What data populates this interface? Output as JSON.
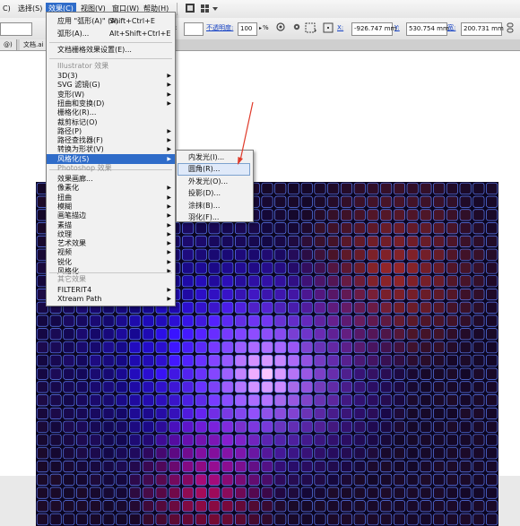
{
  "menubar": {
    "items": [
      {
        "label": "C)"
      },
      {
        "label": "选择(S)"
      },
      {
        "label": "效果(C)"
      },
      {
        "label": "视图(V)"
      },
      {
        "label": "窗口(W)"
      },
      {
        "label": "帮助(H)"
      }
    ]
  },
  "controlbar": {
    "style_suffix": "式:",
    "opacity_label": "不透明度:",
    "opacity_value": "100",
    "percent": "%",
    "x_label": "X:",
    "x_value": "-926.747 mm",
    "y_label": "Y:",
    "y_value": "530.754 mm",
    "w_label": "宽:",
    "w_value": "200.731 mm"
  },
  "tabs": [
    {
      "label": "@)"
    },
    {
      "label": "文档.ai"
    }
  ],
  "effect_menu": {
    "apply_last": {
      "label": "应用 \"弧形(A)\" (A)",
      "shortcut": "Shift+Ctrl+E"
    },
    "last_effect": {
      "label": "弧形(A)...",
      "shortcut": "Alt+Shift+Ctrl+E"
    },
    "doc_raster": {
      "label": "文档栅格效果设置(E)..."
    },
    "illustrator_heading": "Illustrator 效果",
    "illustrator_items": [
      {
        "label": "3D(3)",
        "submenu": true
      },
      {
        "label": "SVG 滤镜(G)",
        "submenu": true
      },
      {
        "label": "变形(W)",
        "submenu": true
      },
      {
        "label": "扭曲和变换(D)",
        "submenu": true
      },
      {
        "label": "栅格化(R)...",
        "submenu": false
      },
      {
        "label": "裁剪标记(O)",
        "submenu": false
      },
      {
        "label": "路径(P)",
        "submenu": true
      },
      {
        "label": "路径查找器(F)",
        "submenu": true
      },
      {
        "label": "转换为形状(V)",
        "submenu": true
      },
      {
        "label": "风格化(S)",
        "submenu": true,
        "highlight": true
      }
    ],
    "photoshop_heading": "Photoshop 效果",
    "photoshop_items": [
      {
        "label": "效果画廊...",
        "submenu": false
      },
      {
        "label": "像素化",
        "submenu": true
      },
      {
        "label": "扭曲",
        "submenu": true
      },
      {
        "label": "模糊",
        "submenu": true
      },
      {
        "label": "画笔描边",
        "submenu": true
      },
      {
        "label": "素描",
        "submenu": true
      },
      {
        "label": "纹理",
        "submenu": true
      },
      {
        "label": "艺术效果",
        "submenu": true
      },
      {
        "label": "视频",
        "submenu": true
      },
      {
        "label": "锐化",
        "submenu": true
      },
      {
        "label": "风格化",
        "submenu": true
      }
    ],
    "other_heading": "其它效果",
    "other_items": [
      {
        "label": "FILTERIT4",
        "submenu": true
      },
      {
        "label": "Xtream Path",
        "submenu": true
      }
    ]
  },
  "stylize_submenu": {
    "items": [
      {
        "label": "内发光(I)..."
      },
      {
        "label": "圆角(R)...",
        "hover": true
      },
      {
        "label": "外发光(O)..."
      },
      {
        "label": "投影(D)..."
      },
      {
        "label": "涂抹(B)..."
      },
      {
        "label": "羽化(F)..."
      }
    ]
  },
  "colors": {
    "menu_highlight": "#2f6cc9",
    "selection_outline": "#5d7cf5",
    "annotation_arrow": "#e03a2a"
  },
  "artwork": {
    "rows": 26,
    "cols": 35
  }
}
